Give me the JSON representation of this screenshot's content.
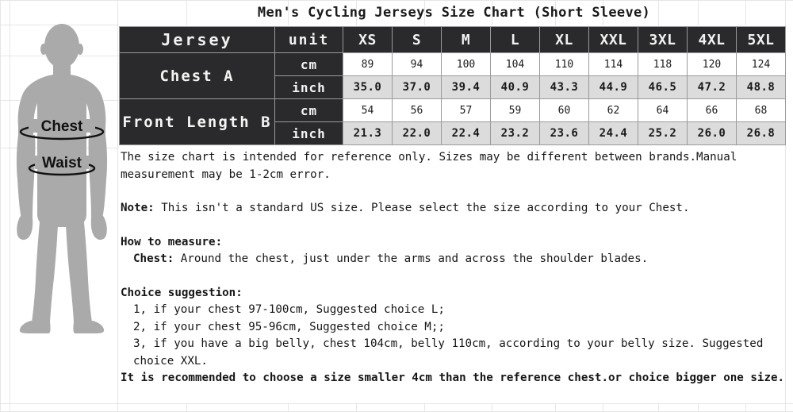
{
  "title": "Men's Cycling Jerseys Size Chart  (Short Sleeve)",
  "figure": {
    "chest_label": "Chest",
    "waist_label": "Waist",
    "silhouette_color": "#aaaaaa"
  },
  "table": {
    "col1_header": "Jersey",
    "col2_header": "unit",
    "sizes": [
      "XS",
      "S",
      "M",
      "L",
      "XL",
      "XXL",
      "3XL",
      "4XL",
      "5XL"
    ],
    "rows": [
      {
        "label": "Chest A",
        "units": [
          {
            "unit": "cm",
            "values": [
              "89",
              "94",
              "100",
              "104",
              "110",
              "114",
              "118",
              "120",
              "124"
            ]
          },
          {
            "unit": "inch",
            "values": [
              "35.0",
              "37.0",
              "39.4",
              "40.9",
              "43.3",
              "44.9",
              "46.5",
              "47.2",
              "48.8"
            ]
          }
        ]
      },
      {
        "label": "Front Length B",
        "units": [
          {
            "unit": "cm",
            "values": [
              "54",
              "56",
              "57",
              "59",
              "60",
              "62",
              "64",
              "66",
              "68"
            ]
          },
          {
            "unit": "inch",
            "values": [
              "21.3",
              "22.0",
              "22.4",
              "23.2",
              "23.6",
              "24.4",
              "25.2",
              "26.0",
              "26.8"
            ]
          }
        ]
      }
    ],
    "header_bg": "#2a2a2c",
    "cm_row_bg": "#ffffff",
    "inch_row_bg": "#dcdcdc"
  },
  "notes": {
    "disclaimer": "The size chart is intended for reference only. Sizes may be different between brands.Manual measurement may be 1-2cm error.",
    "note_label": "Note:",
    "note_text": " This isn't a standard US size. Please select the size according to your Chest.",
    "how_to_measure_heading": "How to measure:",
    "chest_label": "Chest:",
    "chest_text": " Around the chest, just under the arms and across the shoulder blades.",
    "choice_heading": "Choice suggestion:",
    "choice_items": [
      "1, if your chest 97-100cm, Suggested choice L;",
      "2, if your chest 95-96cm, Suggested choice M;;",
      "3, if you have a big belly, chest 104cm, belly 110cm, according to your belly size. Suggested choice XXL."
    ],
    "recommendation": "It is recommended to choose a size smaller 4cm than the reference chest.or choice bigger one size."
  }
}
